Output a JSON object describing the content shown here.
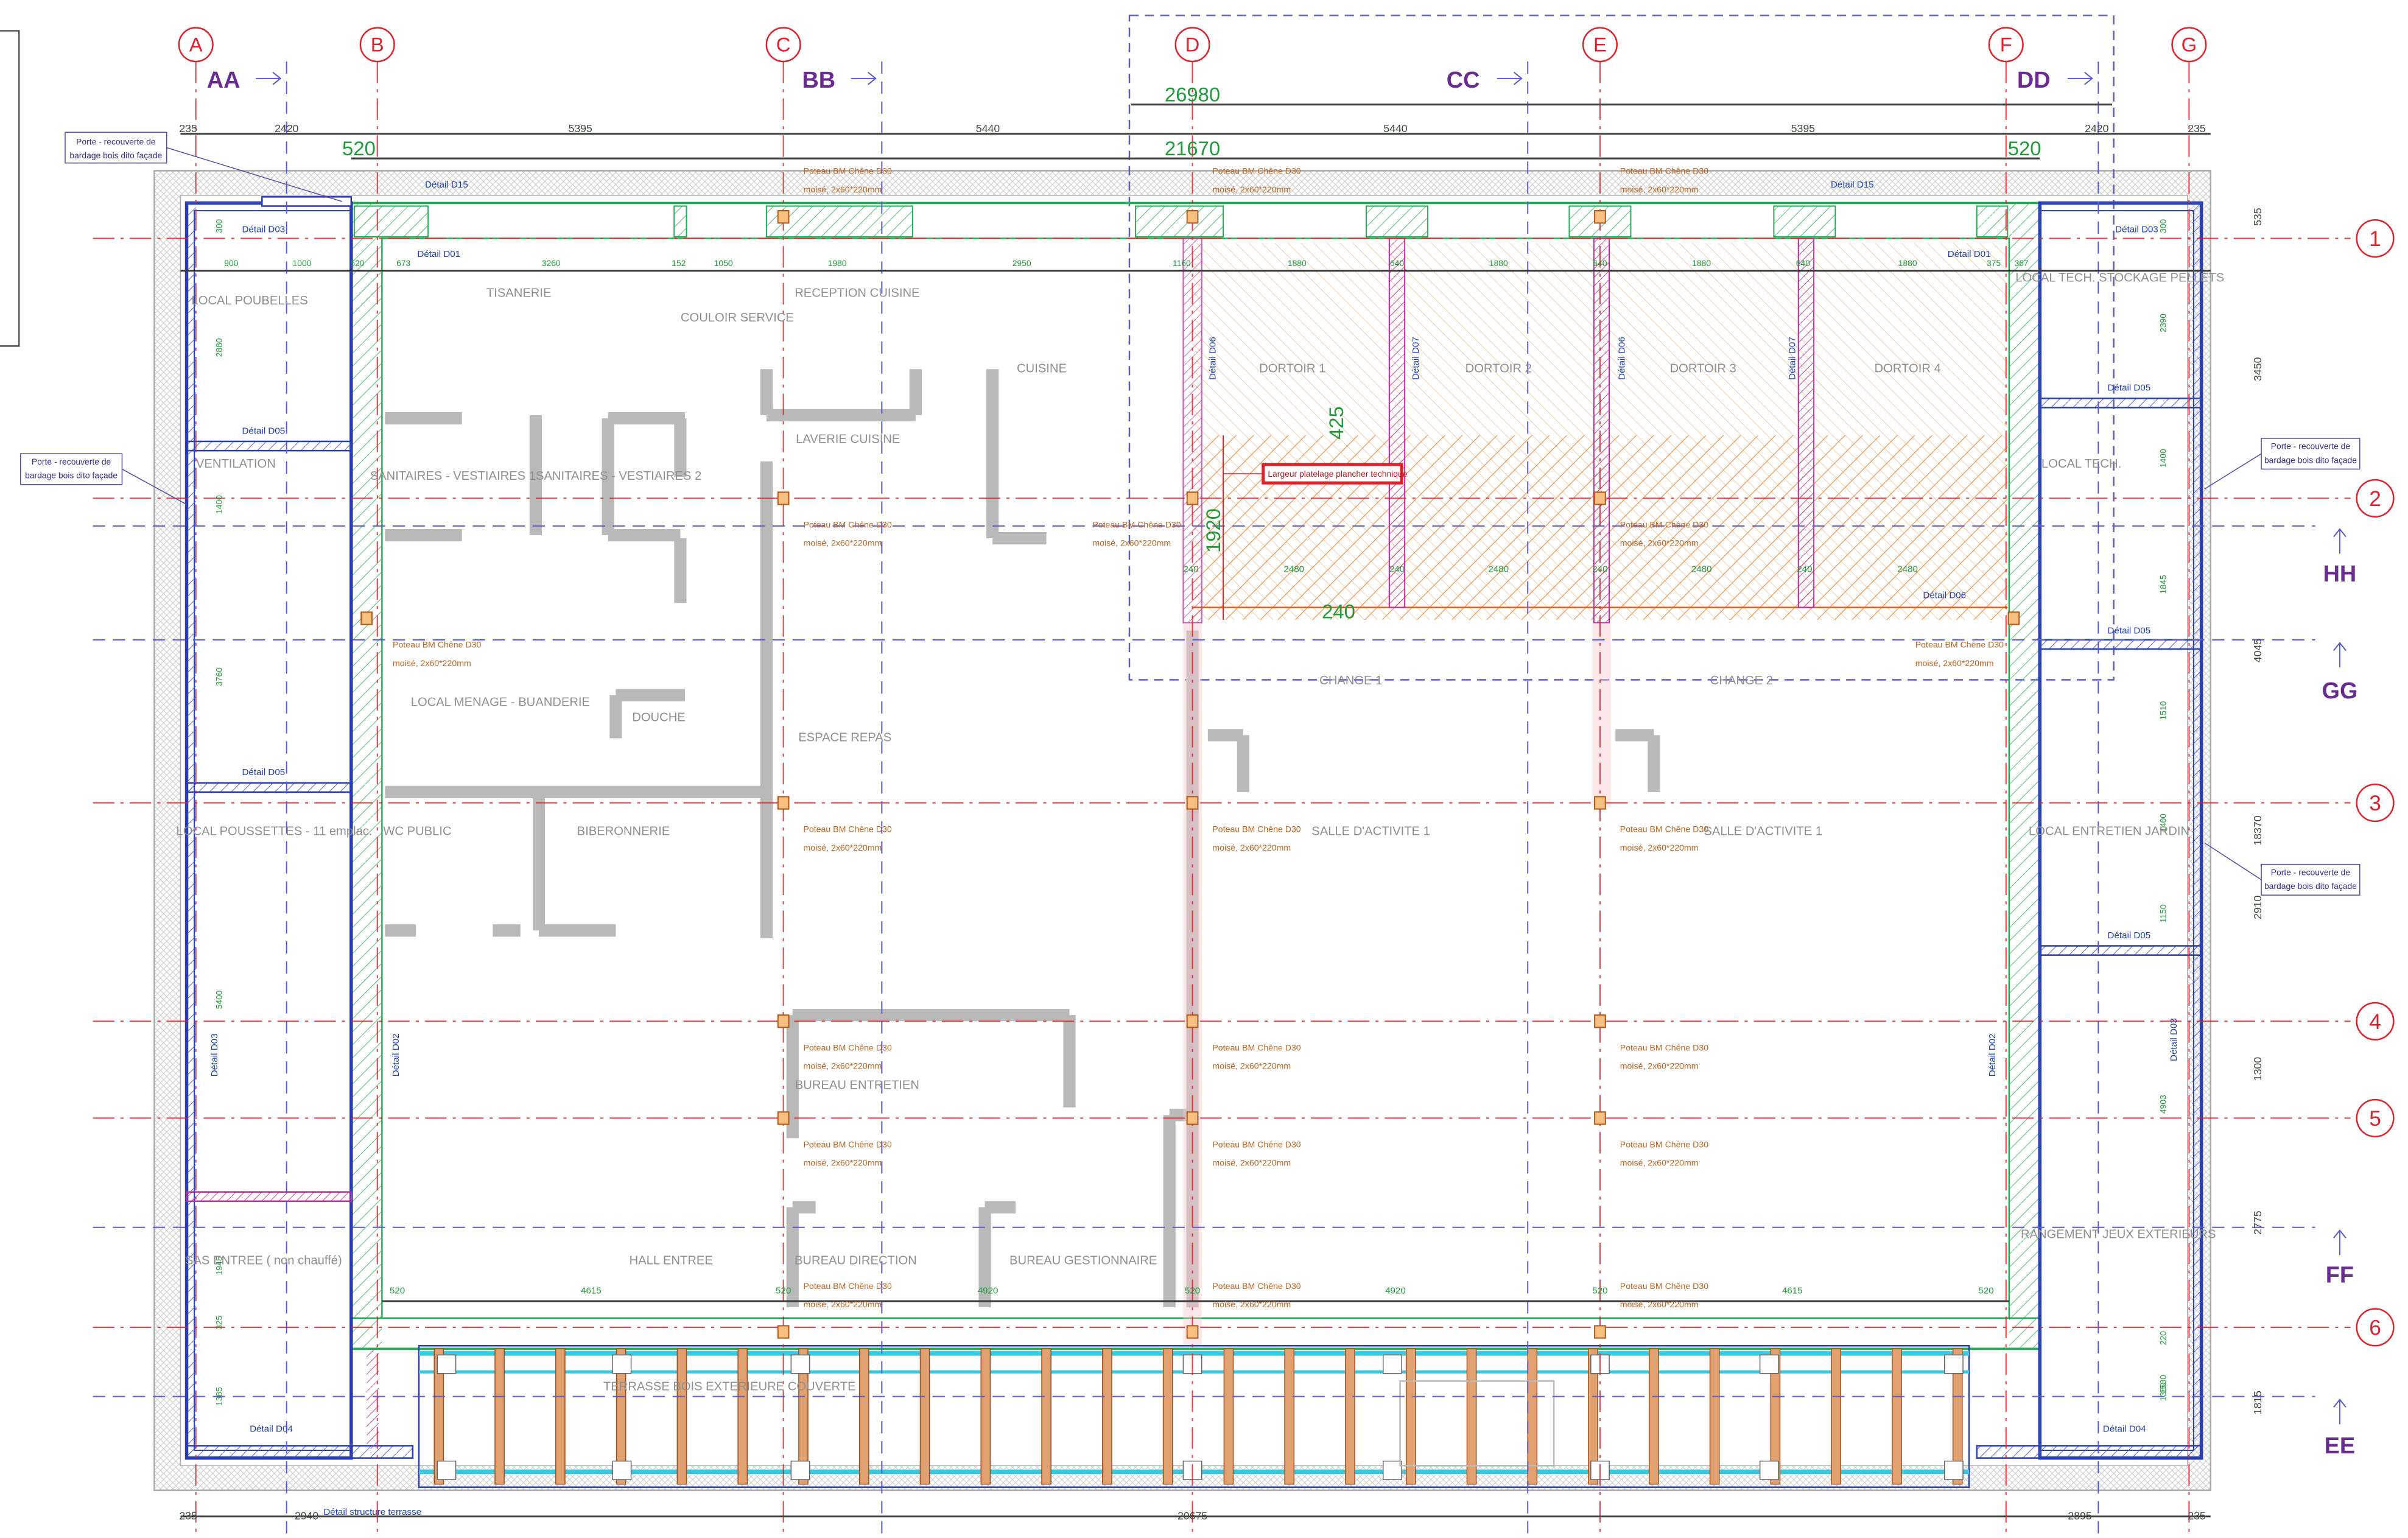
{
  "grid": {
    "columns": [
      "A",
      "B",
      "C",
      "D",
      "E",
      "F",
      "G"
    ],
    "rows": [
      "1",
      "2",
      "3",
      "4",
      "5",
      "6"
    ]
  },
  "sections": {
    "top": [
      "AA",
      "BB",
      "CC",
      "DD"
    ],
    "right": [
      "HH",
      "GG",
      "FF",
      "EE"
    ]
  },
  "dimensions": {
    "top_overall": "26980",
    "top_inner": "21670",
    "top_row": [
      "235",
      "2420",
      "5395",
      "5440",
      "5440",
      "5395",
      "2420",
      "235"
    ],
    "top_small_left": "520",
    "top_small_right": "520",
    "interior_row": [
      "900",
      "1000",
      "520",
      "673",
      "3260",
      "152",
      "1050",
      "1980",
      "2950",
      "1160",
      "1880",
      "640",
      "1880",
      "640",
      "1880",
      "640",
      "1880",
      "375",
      "367"
    ],
    "dortoir_row": [
      "240",
      "2480",
      "240",
      "2480",
      "240",
      "2480",
      "240",
      "2480"
    ],
    "dortoir_small": [
      "425",
      "1920",
      "240"
    ],
    "bottom_row": [
      "520",
      "4615",
      "520",
      "4920",
      "520",
      "4920",
      "520",
      "4615",
      "520"
    ],
    "bottom_overall": [
      "235",
      "2940",
      "20675",
      "2895",
      "235"
    ],
    "right_col": [
      "535",
      "3450",
      "4045",
      "18370",
      "2910",
      "1300",
      "2775",
      "1815"
    ],
    "left_inner": [
      "300",
      "2880",
      "1400",
      "3760",
      "5400",
      "1945",
      "325",
      "1385"
    ],
    "right_inner": [
      "300",
      "2390",
      "1400",
      "1845",
      "1510",
      "1400",
      "1150",
      "4903",
      "1380",
      "220",
      "1580"
    ]
  },
  "rooms": {
    "local_poubelles": "LOCAL POUBELLES",
    "tisanerie": "TISANERIE",
    "couloir_service": "COULOIR SERVICE",
    "reception_cuisine": "RECEPTION CUISINE",
    "cuisine": "CUISINE",
    "dortoir1": "DORTOIR 1",
    "dortoir2": "DORTOIR 2",
    "dortoir3": "DORTOIR 3",
    "dortoir4": "DORTOIR 4",
    "local_tech_stockage": "LOCAL TECH. STOCKAGE PELLETS",
    "ventilation": "VENTILATION",
    "sanitaires": "SANITAIRES - VESTIAIRES 1SANITAIRES - VESTIAIRES 2",
    "laverie": "LAVERIE CUISINE",
    "local_tech": "LOCAL TECH.",
    "local_menage": "LOCAL MENAGE - BUANDERIE",
    "douche": "DOUCHE",
    "espace_repas": "ESPACE REPAS",
    "change1": "CHANGE 1",
    "change2": "CHANGE 2",
    "local_poussettes": "LOCAL POUSSETTES - 11 emplac.",
    "wc_public": "WC PUBLIC",
    "biberonnerie": "BIBERONNERIE",
    "salle1": "SALLE D'ACTIVITE 1",
    "salle2": "SALLE D'ACTIVITE 1",
    "local_entretien": "LOCAL ENTRETIEN JARDIN",
    "bureau_entretien": "BUREAU ENTRETIEN",
    "sas_entree": "SAS ENTREE ( non chauffé)",
    "hall_entree": "HALL ENTREE",
    "bureau_direction": "BUREAU DIRECTION",
    "bureau_gestionnaire": "BUREAU GESTIONNAIRE",
    "rangement": "RANGEMENT JEUX EXTERIEURS",
    "terrasse": "TERRASSE BOIS EXTERIEURE COUVERTE"
  },
  "details": {
    "d15": "Détail D15",
    "d03": "Détail D03",
    "d01": "Détail D01",
    "d05": "Détail D05",
    "d06": "Détail D06",
    "d07": "Détail D07",
    "d02": "Détail D02",
    "d04": "Détail D04",
    "terrasse_structure": "Détail structure terrasse"
  },
  "poteau": {
    "line1": "Poteau BM Chêne D30",
    "line2": "moisé, 2x60*220mm"
  },
  "notes": {
    "porte_line1": "Porte - recouverte de",
    "porte_line2": "bardage bois dito façade",
    "largeur": "Largeur platelage plancher technique"
  },
  "colors": {
    "grid": "#e0212b",
    "section": "#6a2c91",
    "wall_blue": "#2a3fb0",
    "wall_green": "#25b057",
    "poteau": "#c0641e",
    "hatch_orange": "#f0a060",
    "dimension": "#1f9c3a"
  }
}
